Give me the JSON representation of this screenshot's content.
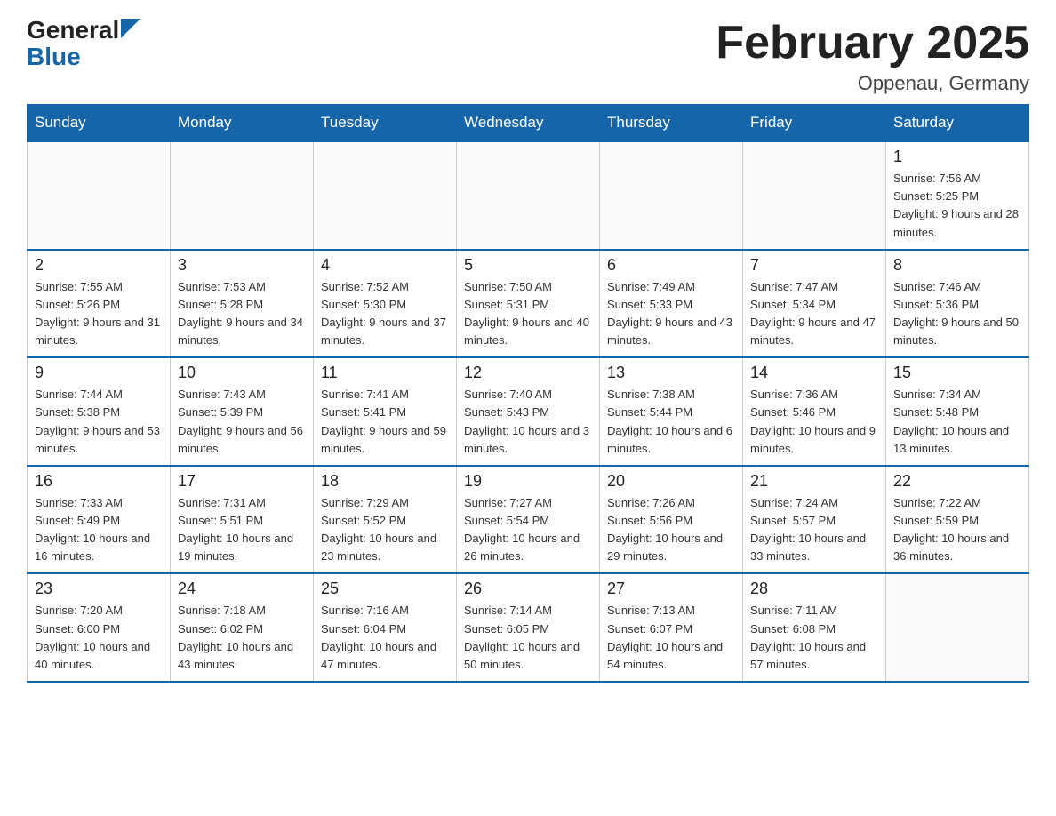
{
  "logo": {
    "general": "General",
    "blue": "Blue"
  },
  "title": {
    "month_year": "February 2025",
    "location": "Oppenau, Germany"
  },
  "days_of_week": [
    "Sunday",
    "Monday",
    "Tuesday",
    "Wednesday",
    "Thursday",
    "Friday",
    "Saturday"
  ],
  "weeks": [
    [
      {
        "day": "",
        "info": ""
      },
      {
        "day": "",
        "info": ""
      },
      {
        "day": "",
        "info": ""
      },
      {
        "day": "",
        "info": ""
      },
      {
        "day": "",
        "info": ""
      },
      {
        "day": "",
        "info": ""
      },
      {
        "day": "1",
        "info": "Sunrise: 7:56 AM\nSunset: 5:25 PM\nDaylight: 9 hours and 28 minutes."
      }
    ],
    [
      {
        "day": "2",
        "info": "Sunrise: 7:55 AM\nSunset: 5:26 PM\nDaylight: 9 hours and 31 minutes."
      },
      {
        "day": "3",
        "info": "Sunrise: 7:53 AM\nSunset: 5:28 PM\nDaylight: 9 hours and 34 minutes."
      },
      {
        "day": "4",
        "info": "Sunrise: 7:52 AM\nSunset: 5:30 PM\nDaylight: 9 hours and 37 minutes."
      },
      {
        "day": "5",
        "info": "Sunrise: 7:50 AM\nSunset: 5:31 PM\nDaylight: 9 hours and 40 minutes."
      },
      {
        "day": "6",
        "info": "Sunrise: 7:49 AM\nSunset: 5:33 PM\nDaylight: 9 hours and 43 minutes."
      },
      {
        "day": "7",
        "info": "Sunrise: 7:47 AM\nSunset: 5:34 PM\nDaylight: 9 hours and 47 minutes."
      },
      {
        "day": "8",
        "info": "Sunrise: 7:46 AM\nSunset: 5:36 PM\nDaylight: 9 hours and 50 minutes."
      }
    ],
    [
      {
        "day": "9",
        "info": "Sunrise: 7:44 AM\nSunset: 5:38 PM\nDaylight: 9 hours and 53 minutes."
      },
      {
        "day": "10",
        "info": "Sunrise: 7:43 AM\nSunset: 5:39 PM\nDaylight: 9 hours and 56 minutes."
      },
      {
        "day": "11",
        "info": "Sunrise: 7:41 AM\nSunset: 5:41 PM\nDaylight: 9 hours and 59 minutes."
      },
      {
        "day": "12",
        "info": "Sunrise: 7:40 AM\nSunset: 5:43 PM\nDaylight: 10 hours and 3 minutes."
      },
      {
        "day": "13",
        "info": "Sunrise: 7:38 AM\nSunset: 5:44 PM\nDaylight: 10 hours and 6 minutes."
      },
      {
        "day": "14",
        "info": "Sunrise: 7:36 AM\nSunset: 5:46 PM\nDaylight: 10 hours and 9 minutes."
      },
      {
        "day": "15",
        "info": "Sunrise: 7:34 AM\nSunset: 5:48 PM\nDaylight: 10 hours and 13 minutes."
      }
    ],
    [
      {
        "day": "16",
        "info": "Sunrise: 7:33 AM\nSunset: 5:49 PM\nDaylight: 10 hours and 16 minutes."
      },
      {
        "day": "17",
        "info": "Sunrise: 7:31 AM\nSunset: 5:51 PM\nDaylight: 10 hours and 19 minutes."
      },
      {
        "day": "18",
        "info": "Sunrise: 7:29 AM\nSunset: 5:52 PM\nDaylight: 10 hours and 23 minutes."
      },
      {
        "day": "19",
        "info": "Sunrise: 7:27 AM\nSunset: 5:54 PM\nDaylight: 10 hours and 26 minutes."
      },
      {
        "day": "20",
        "info": "Sunrise: 7:26 AM\nSunset: 5:56 PM\nDaylight: 10 hours and 29 minutes."
      },
      {
        "day": "21",
        "info": "Sunrise: 7:24 AM\nSunset: 5:57 PM\nDaylight: 10 hours and 33 minutes."
      },
      {
        "day": "22",
        "info": "Sunrise: 7:22 AM\nSunset: 5:59 PM\nDaylight: 10 hours and 36 minutes."
      }
    ],
    [
      {
        "day": "23",
        "info": "Sunrise: 7:20 AM\nSunset: 6:00 PM\nDaylight: 10 hours and 40 minutes."
      },
      {
        "day": "24",
        "info": "Sunrise: 7:18 AM\nSunset: 6:02 PM\nDaylight: 10 hours and 43 minutes."
      },
      {
        "day": "25",
        "info": "Sunrise: 7:16 AM\nSunset: 6:04 PM\nDaylight: 10 hours and 47 minutes."
      },
      {
        "day": "26",
        "info": "Sunrise: 7:14 AM\nSunset: 6:05 PM\nDaylight: 10 hours and 50 minutes."
      },
      {
        "day": "27",
        "info": "Sunrise: 7:13 AM\nSunset: 6:07 PM\nDaylight: 10 hours and 54 minutes."
      },
      {
        "day": "28",
        "info": "Sunrise: 7:11 AM\nSunset: 6:08 PM\nDaylight: 10 hours and 57 minutes."
      },
      {
        "day": "",
        "info": ""
      }
    ]
  ]
}
